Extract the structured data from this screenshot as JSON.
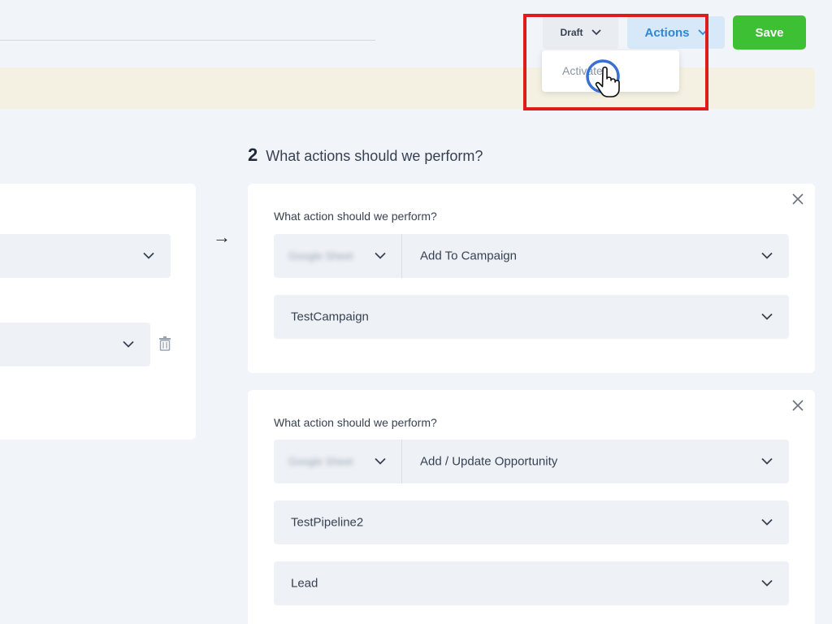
{
  "toolbar": {
    "status_label": "Draft",
    "actions_label": "Actions",
    "save_label": "Save"
  },
  "status_dropdown": {
    "items": [
      {
        "label": "Activate"
      }
    ]
  },
  "section": {
    "number": "2",
    "title": "What actions should we perform?"
  },
  "actions": [
    {
      "label": "What action should we perform?",
      "app_blurred": "Google Sheet",
      "action_value": "Add To Campaign",
      "fields": [
        "TestCampaign"
      ]
    },
    {
      "label": "What action should we perform?",
      "app_blurred": "Google Sheet",
      "action_value": "Add / Update Opportunity",
      "fields": [
        "TestPipeline2",
        "Lead"
      ]
    }
  ],
  "colors": {
    "save_green": "#3ec034",
    "actions_blue": "#2f86d6",
    "highlight_red": "#e01b1b",
    "banner": "#f4f1e2"
  }
}
